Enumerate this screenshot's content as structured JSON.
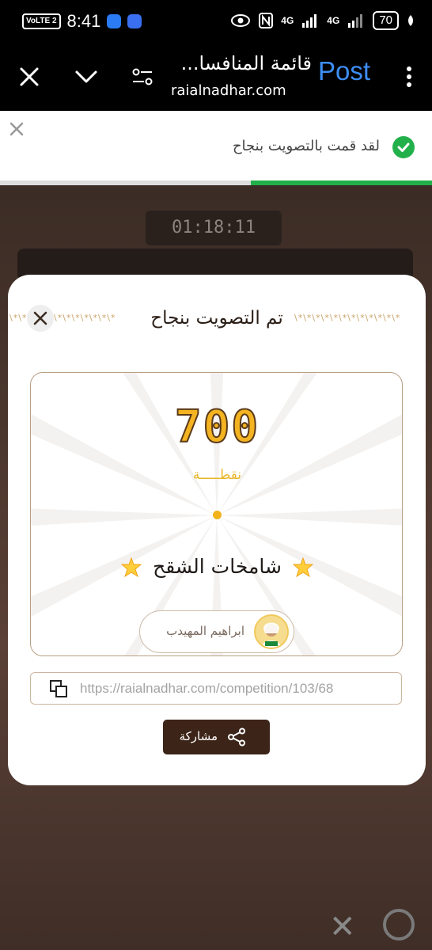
{
  "status_bar": {
    "volte": "VoLTE 2",
    "time": "8:41",
    "signal1": "4G",
    "signal2": "4G",
    "battery": "70"
  },
  "browser": {
    "title": "قائمة المنافسا...",
    "url": "raialnadhar.com",
    "post_label": "Post",
    "icons": [
      "close-icon",
      "chevron-down-icon",
      "settings-sliders-icon",
      "more-vert-icon"
    ]
  },
  "toast": {
    "message": "لقد قمت بالتصويت بنجاح",
    "progress": 0.42,
    "accent": "#22b04b"
  },
  "background_page": {
    "timer": "01:18:11"
  },
  "modal": {
    "title": "تم التصويت بنجاح",
    "deco_pattern": "\\*\\*\\*\\*\\*\\*\\*\\*\\*\\*\\*\\*",
    "points_value": "700",
    "points_label": "نقطـــــة",
    "group_name": "شامخات الشقح",
    "member_name": "ابراهيم المهيدب",
    "share_url": "https://raialnadhar.com/competition/103/68",
    "share_label": "مشاركة",
    "colors": {
      "gold": "#f4b321",
      "brown": "#3c2418"
    }
  }
}
